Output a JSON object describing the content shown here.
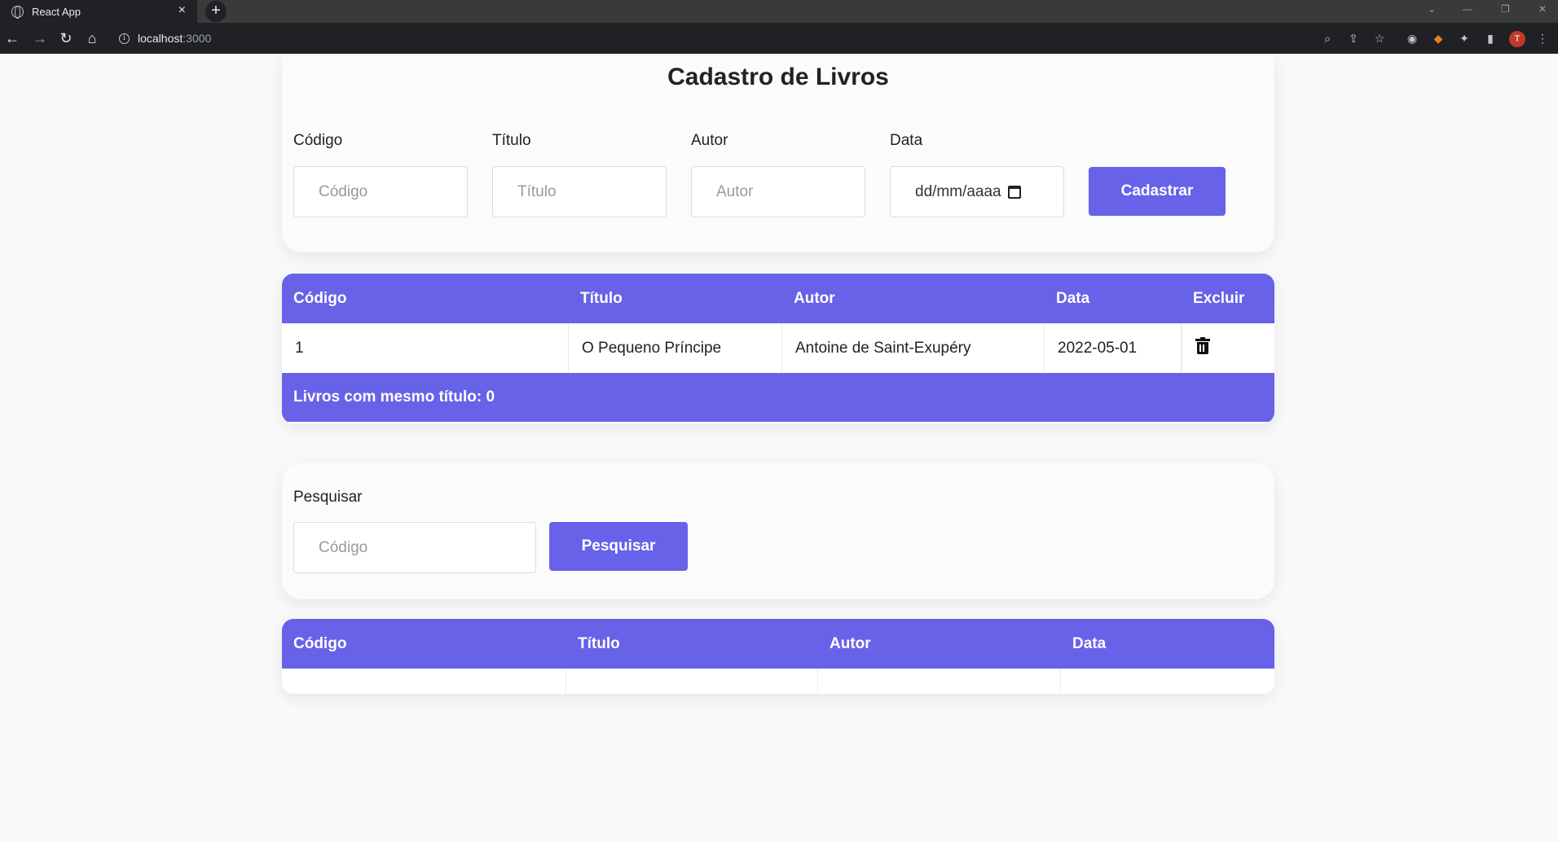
{
  "browser": {
    "tab_title": "React App",
    "tab_close": "×",
    "new_tab": "+",
    "url_host": "localhost",
    "url_port": ":3000",
    "profile_initial": "T"
  },
  "page": {
    "title": "Cadastro de Livros",
    "form": {
      "codigo_label": "Código",
      "titulo_label": "Título",
      "autor_label": "Autor",
      "data_label": "Data",
      "codigo_placeholder": "Código",
      "titulo_placeholder": "Título",
      "autor_placeholder": "Autor",
      "data_placeholder": "dd/mm/aaaa",
      "submit_label": "Cadastrar"
    },
    "books_table": {
      "headers": [
        "Código",
        "Título",
        "Autor",
        "Data",
        "Excluir"
      ],
      "rows": [
        {
          "codigo": "1",
          "titulo": "O Pequeno Príncipe",
          "autor": "Antoine de Saint-Exupéry",
          "data": "2022-05-01",
          "excluir_icon": "trash-icon"
        }
      ],
      "footer": "Livros com mesmo título: 0"
    },
    "search": {
      "label": "Pesquisar",
      "placeholder": "Código",
      "button_label": "Pesquisar"
    },
    "results_table": {
      "headers": [
        "Código",
        "Título",
        "Autor",
        "Data"
      ]
    }
  },
  "colors": {
    "accent": "#6762e8",
    "background": "#f9f9f9",
    "chrome": "#202124"
  }
}
